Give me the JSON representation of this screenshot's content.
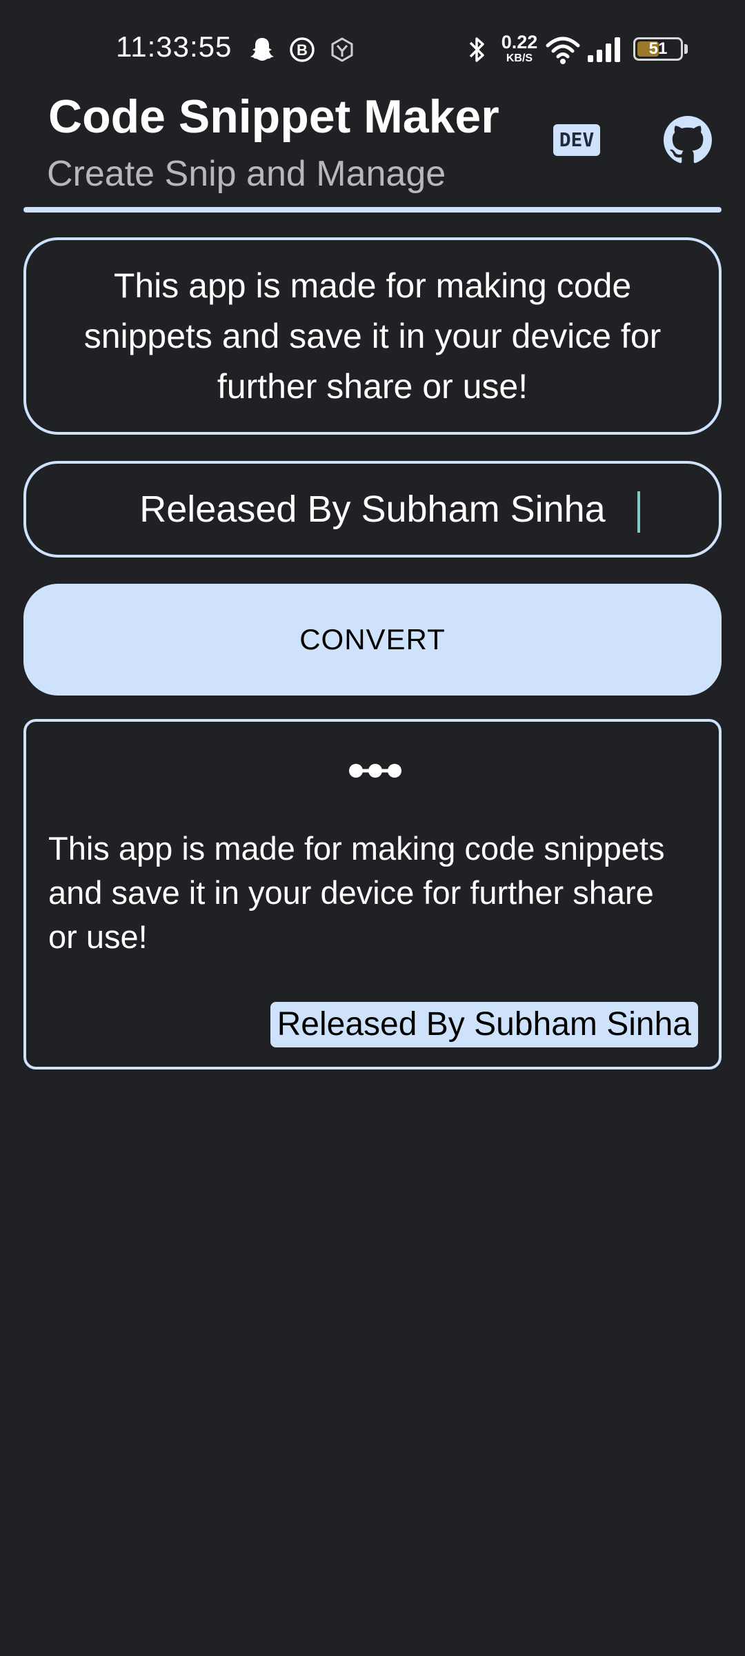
{
  "status_bar": {
    "time": "11:33:55",
    "net_speed": "0.22",
    "net_speed_unit": "KB/S",
    "battery_level": "51",
    "battery_fraction": 0.51,
    "icons": [
      "snapchat-icon",
      "b-circle-icon",
      "app-icon",
      "bluetooth-icon",
      "wifi-icon",
      "signal-icon",
      "battery-icon"
    ]
  },
  "header": {
    "title": "Code Snippet Maker",
    "subtitle": "Create Snip and Manage",
    "badge": "DEV",
    "github_icon": "github-icon"
  },
  "intro": {
    "text": "This app is made for making code snippets and save it in your device for further share or use!"
  },
  "name_input": {
    "value": "Released By Subham Sinha"
  },
  "convert_button": {
    "label": "CONVERT"
  },
  "snippet": {
    "window_icon": "three-dots-icon",
    "text": "This app is made for making code snippets and save it in your device for further share or use!",
    "author": "Released By Subham Sinha"
  },
  "colors": {
    "background": "#202124",
    "accent": "#cfe2fc",
    "cursor": "#80cbc4"
  }
}
